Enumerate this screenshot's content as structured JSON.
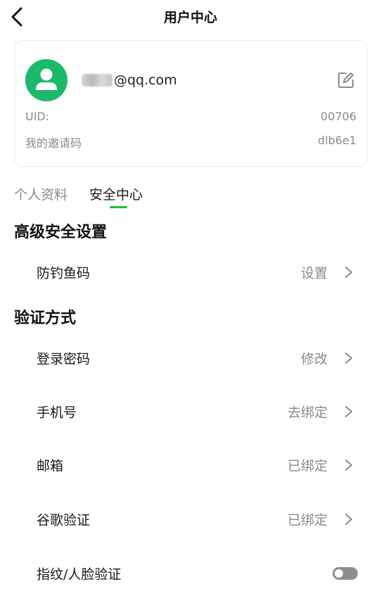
{
  "header": {
    "title": "用户中心"
  },
  "profile": {
    "email_suffix": "@qq.com",
    "uid_label": "UID:",
    "uid_value": "00706",
    "invite_label": "我的邀请码",
    "invite_value": "dlb6e1"
  },
  "tabs": [
    {
      "label": "个人资料",
      "active": false
    },
    {
      "label": "安全中心",
      "active": true
    }
  ],
  "sections": {
    "advanced": {
      "title": "高级安全设置",
      "items": [
        {
          "label": "防钓鱼码",
          "status": "设置"
        }
      ]
    },
    "verification": {
      "title": "验证方式",
      "items": [
        {
          "label": "登录密码",
          "status": "修改"
        },
        {
          "label": "手机号",
          "status": "去绑定"
        },
        {
          "label": "邮箱",
          "status": "已绑定"
        },
        {
          "label": "谷歌验证",
          "status": "已绑定"
        },
        {
          "label": "指纹/人脸验证",
          "toggle_on": false
        }
      ]
    }
  },
  "colors": {
    "accent": "#1dc03b",
    "avatar": "#1bb96a",
    "muted": "#8a8a8a"
  },
  "icons": [
    "back-arrow-icon",
    "user-avatar-icon",
    "edit-icon",
    "chevron-right-icon"
  ]
}
